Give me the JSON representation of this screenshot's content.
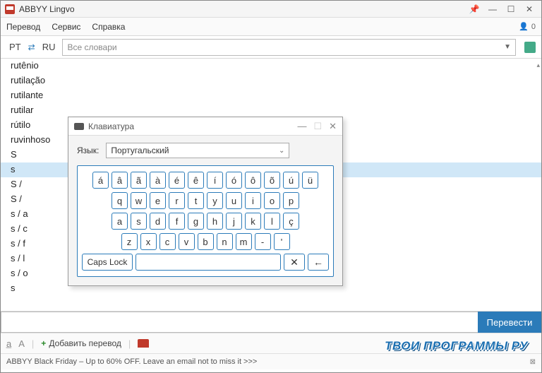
{
  "title": "ABBYY Lingvo",
  "menu": {
    "translate": "Перевод",
    "service": "Сервис",
    "help": "Справка"
  },
  "user_count": "0",
  "langs": {
    "from": "PT",
    "to": "RU"
  },
  "dict_placeholder": "Все словари",
  "words": [
    "rutênio",
    "rutilação",
    "rutilante",
    "rutilar",
    "rútilo",
    "ruvinhoso",
    "S",
    "s",
    "S /",
    "S /",
    "s / a",
    "s / c",
    "s / f",
    "s / l",
    "s / o",
    "s"
  ],
  "selected_index": 7,
  "translate_btn": "Перевести",
  "add_translation": "Добавить перевод",
  "promo_text": "ТВОИ ПРОГРАММЫ РУ",
  "statusbar": "ABBYY Black Friday – Up to 60% OFF. Leave an email not to miss it >>>",
  "kbd": {
    "title": "Клавиатура",
    "lang_label": "Язык:",
    "lang_value": "Португальский",
    "rows": [
      [
        "á",
        "â",
        "ã",
        "à",
        "é",
        "ê",
        "í",
        "ó",
        "ô",
        "õ",
        "ú",
        "ü"
      ],
      [
        "q",
        "w",
        "e",
        "r",
        "t",
        "y",
        "u",
        "i",
        "o",
        "p"
      ],
      [
        "a",
        "s",
        "d",
        "f",
        "g",
        "h",
        "j",
        "k",
        "l",
        "ç"
      ],
      [
        "z",
        "x",
        "c",
        "v",
        "b",
        "n",
        "m",
        "-",
        "'"
      ]
    ],
    "capslock": "Caps Lock",
    "del_sym": "✕",
    "back_sym": "←"
  }
}
